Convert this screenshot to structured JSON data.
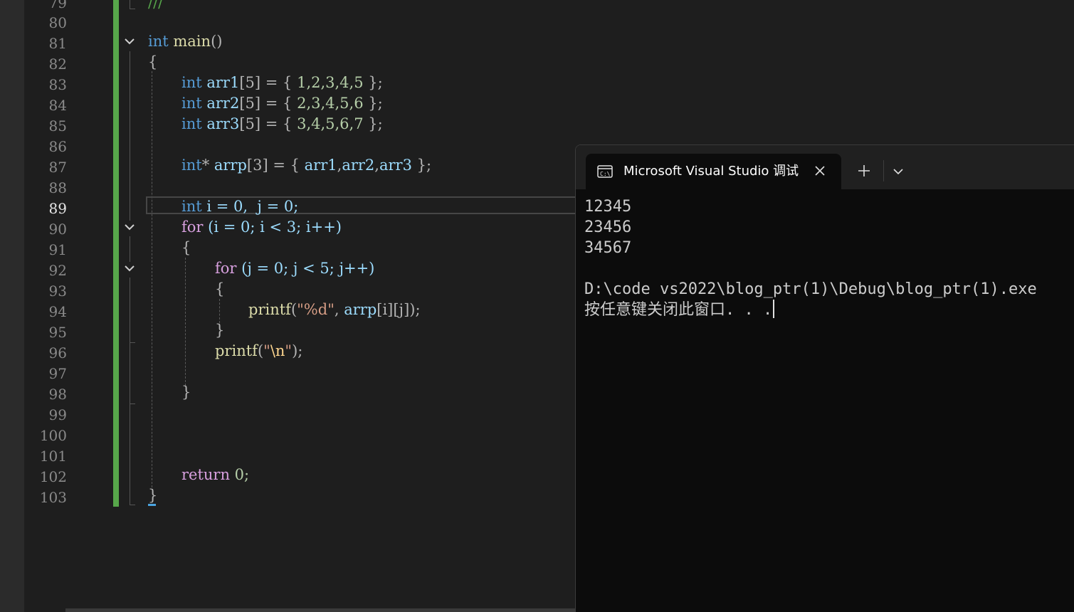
{
  "editor": {
    "line_numbers": [
      "79",
      "80",
      "81",
      "82",
      "83",
      "84",
      "85",
      "86",
      "87",
      "88",
      "89",
      "90",
      "91",
      "92",
      "93",
      "94",
      "95",
      "96",
      "97",
      "98",
      "99",
      "100",
      "101",
      "102",
      "103"
    ],
    "current_line": "89",
    "code": {
      "l79": "///",
      "l81_kw": "int",
      "l81_fn": "main",
      "l81_rest": "()",
      "l82": "{",
      "l83_kw": "int",
      "l83_var": "arr1",
      "l83_idx": "[5] = { ",
      "l83_vals": "1,2,3,4,5",
      "l83_end": " };",
      "l84_kw": "int",
      "l84_var": "arr2",
      "l84_idx": "[5] = { ",
      "l84_vals": "2,3,4,5,6",
      "l84_end": " };",
      "l85_kw": "int",
      "l85_var": "arr3",
      "l85_idx": "[5] = { ",
      "l85_vals": "3,4,5,6,7",
      "l85_end": " };",
      "l87_kw": "int",
      "l87_star": "* ",
      "l87_var": "arrp",
      "l87_idx": "[3] = { ",
      "l87_a": "arr1",
      "l87_c1": ",",
      "l87_b": "arr2",
      "l87_c2": ",",
      "l87_c": "arr3",
      "l87_end": " };",
      "l89_kw": "int",
      "l89_rest": " i = 0,  j = 0;",
      "l90_kw": "for",
      "l90_rest": " (i = 0; i < 3; i++)",
      "l91": "{",
      "l92_kw": "for",
      "l92_rest": " (j = 0; j < 5; j++)",
      "l93": "{",
      "l94_fn": "printf",
      "l94_open": "(",
      "l94_str": "\"%d\"",
      "l94_comma": ", ",
      "l94_var": "arrp",
      "l94_idx": "[i][j]);",
      "l95": "}",
      "l96_fn": "printf",
      "l96_open": "(",
      "l96_q1": "\"",
      "l96_esc": "\\n",
      "l96_q2": "\"",
      "l96_end": ");",
      "l98": "}",
      "l102_kw": "return",
      "l102_rest": " 0;",
      "l103": "}"
    }
  },
  "terminal": {
    "tab_title": "Microsoft Visual Studio 调试控制台",
    "tab_icon": "console-app-icon",
    "close_icon": "close-icon",
    "new_tab_icon": "plus-icon",
    "dropdown_icon": "chevron-down-icon",
    "output": [
      "12345",
      "23456",
      "34567",
      "",
      "D:\\code vs2022\\blog_ptr(1)\\Debug\\blog_ptr(1).exe",
      "按任意键关闭此窗口. . ."
    ]
  },
  "colors": {
    "keyword": "#569cd6",
    "function": "#dcdcaa",
    "variable": "#9cdcfe",
    "number": "#b5cea8",
    "string": "#d69d85",
    "change_bar": "#57a64a",
    "terminal_bg": "#0c0c0c"
  }
}
